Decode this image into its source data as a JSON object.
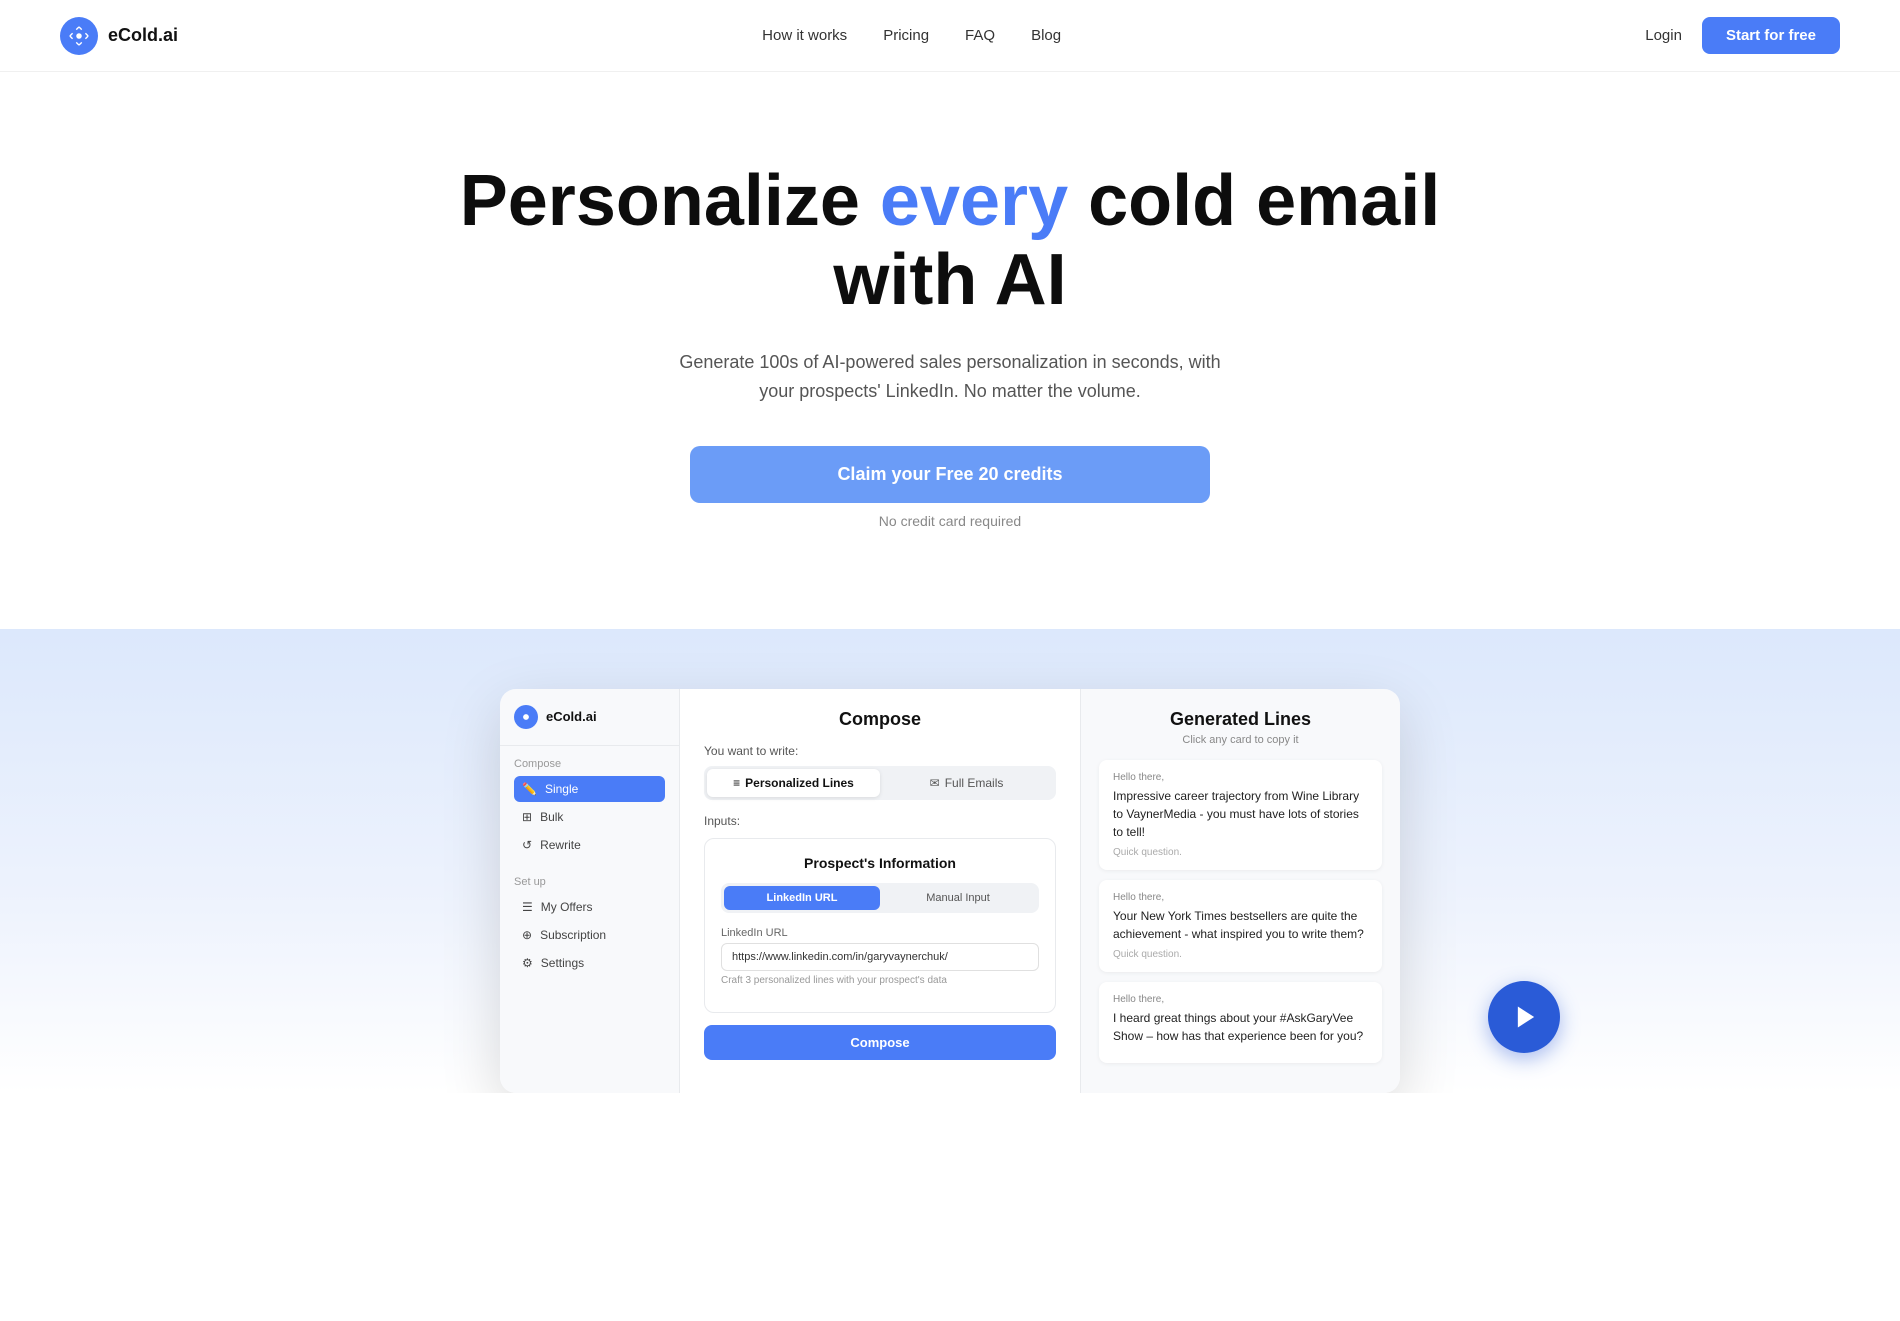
{
  "nav": {
    "logo_text": "eCold.ai",
    "links": [
      {
        "label": "How it works",
        "href": "#"
      },
      {
        "label": "Pricing",
        "href": "#"
      },
      {
        "label": "FAQ",
        "href": "#"
      },
      {
        "label": "Blog",
        "href": "#"
      }
    ],
    "login_label": "Login",
    "start_label": "Start for free"
  },
  "hero": {
    "headline_part1": "Personalize ",
    "headline_accent": "every",
    "headline_part2": " cold email",
    "headline_part3": "with AI",
    "subtitle": "Generate 100s of AI-powered sales personalization in seconds, with your prospects' LinkedIn. No matter the volume.",
    "cta_label": "Claim your Free 20 credits",
    "no_cc": "No credit card required"
  },
  "demo": {
    "sidebar": {
      "logo_text": "eCold.ai",
      "compose_section": "Compose",
      "items_compose": [
        {
          "label": "Single",
          "icon": "✏️",
          "active": true
        },
        {
          "label": "Bulk",
          "icon": "⊞"
        },
        {
          "label": "Rewrite",
          "icon": "↺"
        }
      ],
      "setup_section": "Set up",
      "items_setup": [
        {
          "label": "My Offers",
          "icon": "☰"
        },
        {
          "label": "Subscription",
          "icon": "⊕"
        },
        {
          "label": "Settings",
          "icon": "⚙"
        }
      ]
    },
    "compose": {
      "title": "Compose",
      "you_want_label": "You want to write:",
      "tabs": [
        {
          "label": "Personalized Lines",
          "icon": "≡",
          "active": true
        },
        {
          "label": "Full Emails",
          "icon": "✉",
          "active": false
        }
      ],
      "inputs_label": "Inputs:",
      "prospect_title": "Prospect's Information",
      "input_tabs": [
        {
          "label": "LinkedIn URL",
          "active": true
        },
        {
          "label": "Manual Input",
          "active": false
        }
      ],
      "url_label": "LinkedIn URL",
      "url_value": "https://www.linkedin.com/in/garyvaynerchuk/",
      "url_hint": "Craft 3 personalized lines with your prospect's data",
      "compose_button": "Compose"
    },
    "generated": {
      "title": "Generated Lines",
      "subtitle": "Click any card to copy it",
      "cards": [
        {
          "greeting": "Hello there,",
          "text": "Impressive career trajectory from Wine Library to VaynerMedia - you must have lots of stories to tell!",
          "tag": "Quick question."
        },
        {
          "greeting": "Hello there,",
          "text": "Your New York Times bestsellers are quite the achievement - what inspired you to write them?",
          "tag": "Quick question."
        },
        {
          "greeting": "Hello there,",
          "text": "I heard great things about your #AskGaryVee Show – how has that experience been for you?",
          "tag": ""
        }
      ]
    }
  }
}
